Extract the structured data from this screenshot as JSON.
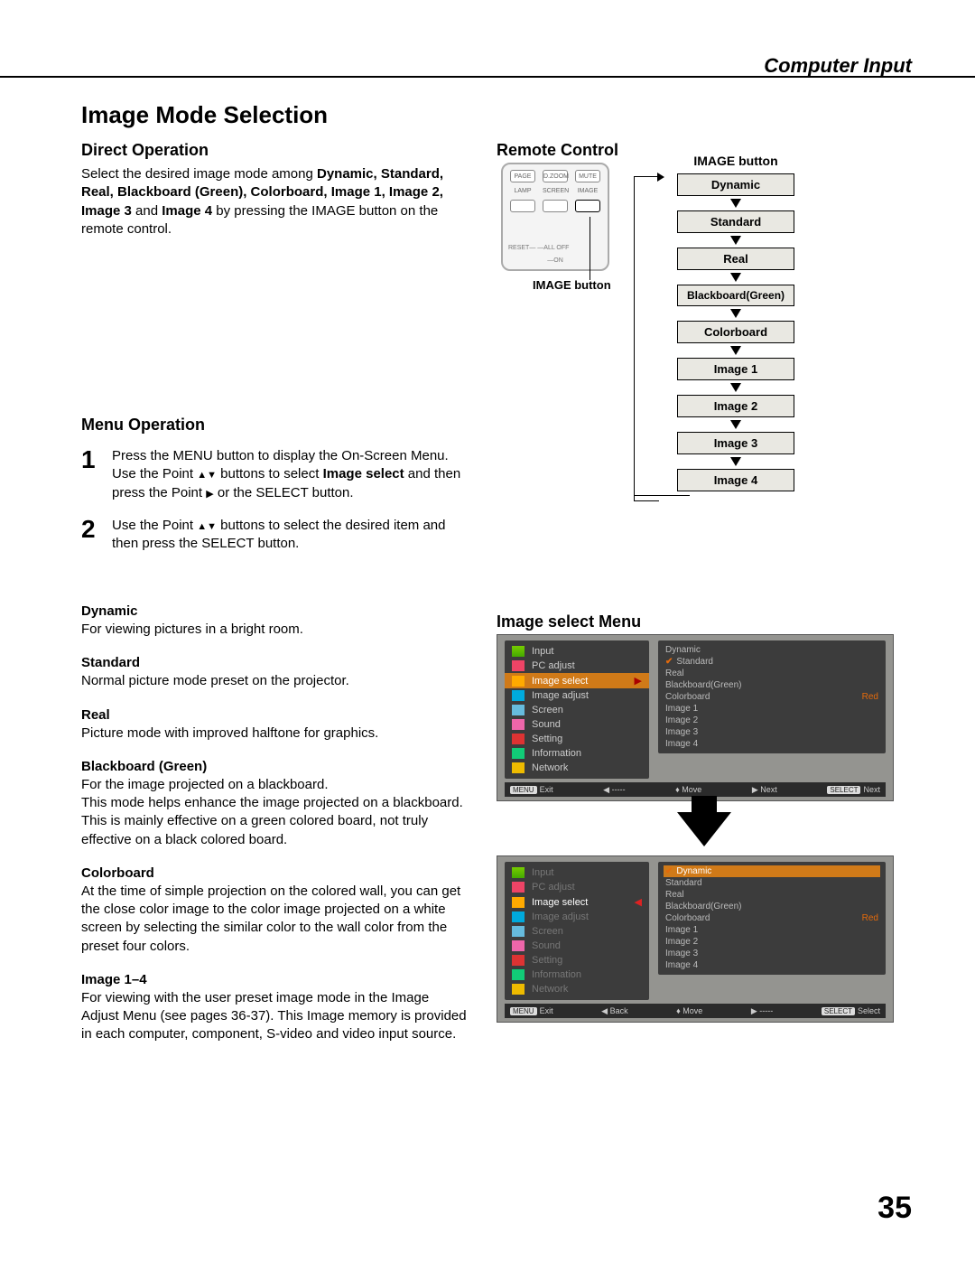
{
  "header": {
    "section": "Computer Input"
  },
  "title": "Image Mode Selection",
  "direct": {
    "heading": "Direct Operation",
    "p_before": "Select the desired image mode among ",
    "p_list": "Dynamic, Standard, Real, Blackboard (Green), Colorboard, Image 1, Image 2, Image 3 ",
    "p_mid": "and ",
    "p_last": "Image 4",
    "p_after": " by pressing the IMAGE button on the remote control."
  },
  "remote": {
    "heading": "Remote Control",
    "callout": "IMAGE button",
    "row1": [
      "PAGE",
      "D.ZOOM",
      "MUTE"
    ],
    "row2": [
      "LAMP",
      "SCREEN",
      "IMAGE"
    ],
    "reset": "RESET— —ALL OFF",
    "on": "—ON"
  },
  "flow": {
    "label": "IMAGE button",
    "items": [
      "Dynamic",
      "Standard",
      "Real",
      "Blackboard(Green)",
      "Colorboard",
      "Image 1",
      "Image 2",
      "Image 3",
      "Image 4"
    ]
  },
  "menu": {
    "heading": "Menu Operation",
    "steps": [
      {
        "n": "1",
        "t1": "Press the MENU button to display the On-Screen Menu. Use the Point ",
        "t2": " buttons to select ",
        "bold": "Image select",
        "t3": " and then press the Point ",
        "t4": " or the SELECT button."
      },
      {
        "n": "2",
        "t1": "Use the Point ",
        "t2": " buttons to select  the desired item and then press the SELECT button."
      }
    ]
  },
  "modes": [
    {
      "name": "Dynamic",
      "desc": "For viewing pictures in a bright room."
    },
    {
      "name": "Standard",
      "desc": "Normal picture mode preset on the projector."
    },
    {
      "name": "Real",
      "desc": "Picture mode with improved halftone for graphics."
    },
    {
      "name": "Blackboard (Green)",
      "desc": "For the image projected on a blackboard.\nThis mode helps enhance the image projected on a blackboard. This is mainly effective on a green colored board, not truly effective on a black colored board."
    },
    {
      "name": "Colorboard",
      "desc": "At the time of simple projection on the colored wall, you can get the close color image to the color image projected on a white screen by selecting the similar color to the wall color from the preset four colors."
    },
    {
      "name": "Image 1–4",
      "desc": "For viewing with the user preset image mode in the Image Adjust Menu (see pages 36-37). This Image memory is provided in each computer, component, S-video and video input source."
    }
  ],
  "osd": {
    "heading": "Image select Menu",
    "menu_items": [
      "Input",
      "PC adjust",
      "Image select",
      "Image adjust",
      "Screen",
      "Sound",
      "Setting",
      "Information",
      "Network"
    ],
    "options": [
      "Dynamic",
      "Standard",
      "Real",
      "Blackboard(Green)",
      "Colorboard",
      "Image 1",
      "Image 2",
      "Image 3",
      "Image 4"
    ],
    "red": "Red",
    "foot1": {
      "exit": "Exit",
      "back": "-----",
      "move": "Move",
      "next": "Next",
      "select": "Next",
      "menu": "MENU",
      "sel": "SELECT"
    },
    "foot2": {
      "exit": "Exit",
      "back": "Back",
      "move": "Move",
      "next": "-----",
      "select": "Select",
      "menu": "MENU",
      "sel": "SELECT"
    }
  },
  "page_number": "35"
}
